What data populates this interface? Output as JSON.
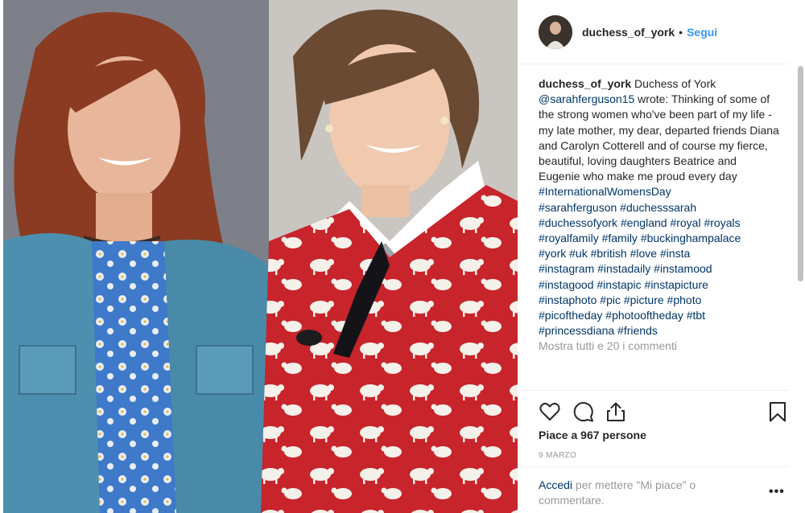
{
  "post": {
    "image_alt": "Two smiling women, one in a denim jacket and one in a red sweater with white sheep"
  },
  "header": {
    "username": "duchess_of_york",
    "separator": "•",
    "follow_label": "Segui"
  },
  "caption": {
    "username": "duchess_of_york",
    "intro": " Duchess of York",
    "mention": "@sarahferguson15",
    "wrote": " wrote:",
    "body": "Thinking of some of the strong women who've been part of my life - my late mother, my dear, departed friends Diana and Carolyn Cotterell and of course my fierce, beautiful, loving daughters Beatrice and Eugenie who make me proud every day",
    "hashtag_lines": [
      "#InternationalWomensDay",
      "#sarahferguson #duchesssarah",
      "#duchessofyork #england #royal #royals",
      "#royalfamily #family #buckinghampalace",
      "#york #uk #british #love #insta",
      "#instagram #instadaily #instamood",
      "#instagood #instapic #instapicture",
      "#instaphoto #pic #picture #photo",
      "#picoftheday #photooftheday #tbt",
      "#princessdiana #friends"
    ],
    "show_all_comments": "Mostra tutti e 20 i commenti"
  },
  "actions": {
    "like_icon": "heart-outline-icon",
    "comment_icon": "speech-bubble-icon",
    "share_icon": "share-arrow-icon",
    "save_icon": "bookmark-icon"
  },
  "likes_text": "Piace a 967 persone",
  "date_text": "9 MARZO",
  "login": {
    "link": "Accedi",
    "rest": " per mettere \"Mi piace\" o commentare.",
    "more_icon": "ellipsis-icon",
    "more_label": "•••"
  },
  "colors": {
    "link": "#003569",
    "follow": "#3897f0",
    "muted": "#999999",
    "text": "#262626",
    "border": "#efefef"
  }
}
